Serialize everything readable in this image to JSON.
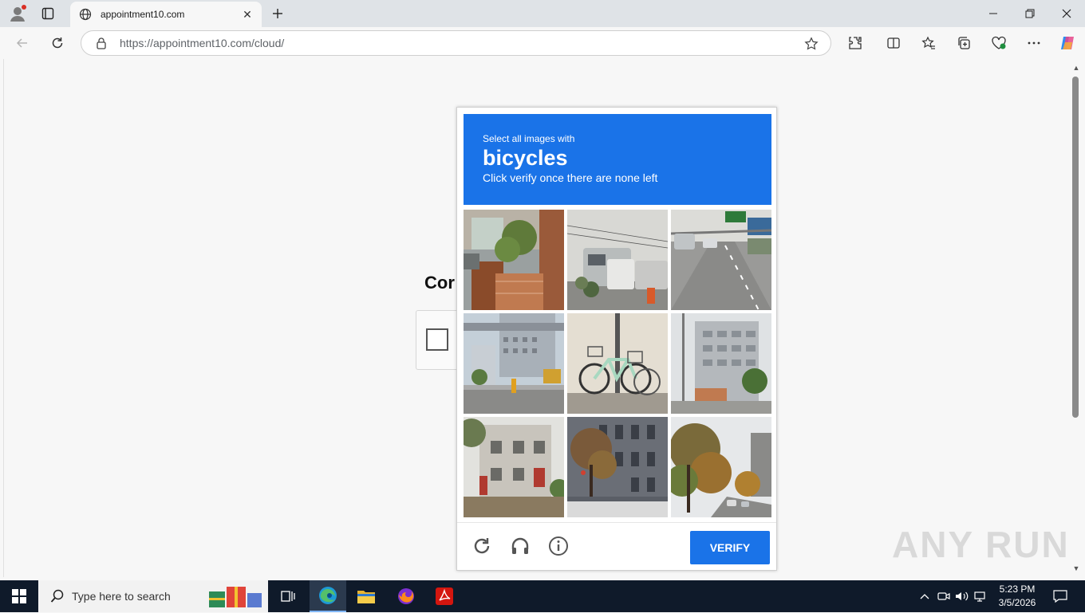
{
  "browser": {
    "tab": {
      "title": "appointment10.com",
      "close_label": "✕"
    },
    "url_host": "https://appointment10.com",
    "url_path": "/cloud/"
  },
  "page": {
    "heading_partial": "Cor"
  },
  "captcha": {
    "instruction_line1": "Select all images with",
    "target_word": "bicycles",
    "instruction_line3": "Click verify once there are none left",
    "verify_label": "VERIFY",
    "header_color": "#1a73e8",
    "tiles": [
      {
        "subject": "brick gate with plants"
      },
      {
        "subject": "parked vans"
      },
      {
        "subject": "highway with cars"
      },
      {
        "subject": "city street with tall buildings"
      },
      {
        "subject": "bicycles against a wall"
      },
      {
        "subject": "office building"
      },
      {
        "subject": "apartment building"
      },
      {
        "subject": "building with trees"
      },
      {
        "subject": "autumn trees on a street"
      }
    ]
  },
  "watermark": "ANY RUN",
  "taskbar": {
    "search_placeholder": "Type here to search",
    "time": "5:23 PM",
    "date": "3/5/2026"
  }
}
